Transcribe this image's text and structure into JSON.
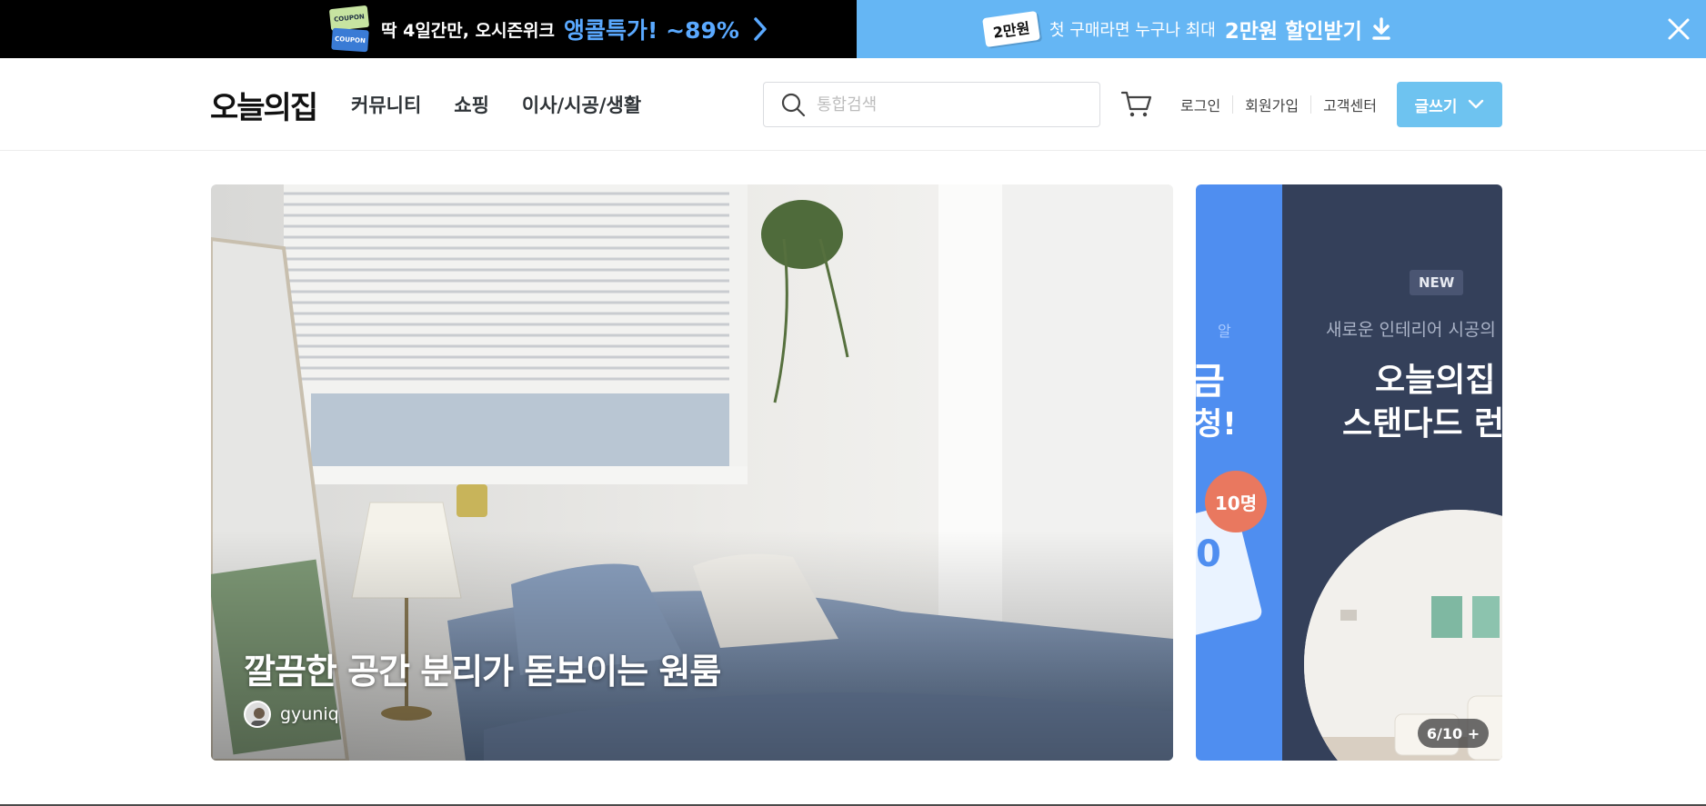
{
  "promo": {
    "left": {
      "coupon_top": "COUPON",
      "coupon_bottom": "COUPON",
      "text": "딱 4일간만, 오시즌위크",
      "highlight": "앵콜특가! ~89%",
      "bg_color": "#000000",
      "highlight_color": "#5aa9ff"
    },
    "right": {
      "badge": "2만원",
      "text": "첫 구매라면 누구나 최대",
      "highlight": "2만원 할인받기",
      "bg_color": "#65b6f4"
    },
    "close_icon": "close-icon"
  },
  "header": {
    "logo": "오늘의집",
    "nav": [
      "커뮤니티",
      "쇼핑",
      "이사/시공/생활"
    ],
    "search_placeholder": "통합검색",
    "links": [
      "로그인",
      "회원가입",
      "고객센터"
    ],
    "write_button": "글쓰기",
    "accent_color": "#6ec3f0"
  },
  "hero": {
    "title": "깔끔한 공간 분리가 돋보이는 원룸",
    "author": "gyuniq"
  },
  "banner": {
    "peek": {
      "line1": "알",
      "line2": "금",
      "line3": "청!",
      "count_badge": "10명",
      "ticket_text": "0"
    },
    "new_tag": "NEW",
    "subtitle": "새로운 인테리어 시공의",
    "headline1": "오늘의집",
    "headline2": "스탠다드 런칭",
    "pager": "6/10 +"
  }
}
